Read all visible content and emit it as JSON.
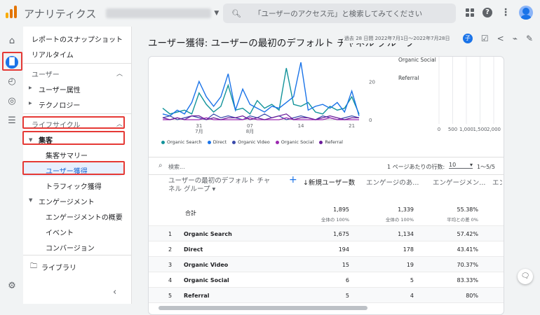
{
  "app": {
    "brand": "アナリティクス"
  },
  "search": {
    "placeholder": "「ユーザーのアクセス元」と検索してみてください"
  },
  "nav": {
    "snapshot": "レポートのスナップショット",
    "realtime": "リアルタイム",
    "user_section": "ユーザー",
    "user_attr": "ユーザー属性",
    "tech": "テクノロジー",
    "lifecycle": "ライフサイクル",
    "acquisition": "集客",
    "acq_overview": "集客サマリー",
    "user_acq": "ユーザー獲得",
    "traffic_acq": "トラフィック獲得",
    "engagement": "エンゲージメント",
    "eng_overview": "エンゲージメントの概要",
    "events": "イベント",
    "conversions": "コンバージョン",
    "library": "ライブラリ"
  },
  "page": {
    "title": "ユーザー獲得: ユーザーの最初のデフォルト チャネル グループ",
    "date": "過去 28 日間 2022年7月1日～2022年7月28日",
    "badge": "子"
  },
  "chart_data": {
    "type": "line",
    "x_tick_labels": [
      "31\n7月",
      "07\n8月",
      "14",
      "21"
    ],
    "y_ticks": [
      0,
      20
    ],
    "series": [
      {
        "name": "Organic Search",
        "color": "#12939a",
        "values": [
          6,
          3,
          4,
          5,
          3,
          14,
          8,
          4,
          7,
          18,
          5,
          6,
          3,
          10,
          6,
          8,
          5,
          27,
          8,
          7,
          9,
          4,
          3,
          7,
          5,
          6,
          12,
          3
        ]
      },
      {
        "name": "Direct",
        "color": "#1a73e8",
        "values": [
          3,
          2,
          5,
          3,
          9,
          20,
          12,
          7,
          12,
          24,
          5,
          16,
          8,
          6,
          4,
          7,
          6,
          9,
          12,
          30,
          5,
          7,
          8,
          6,
          9,
          4,
          15,
          2
        ]
      },
      {
        "name": "Organic Video",
        "color": "#3949ab",
        "values": [
          1,
          2,
          0,
          1,
          2,
          1,
          0,
          3,
          1,
          2,
          1,
          0,
          2,
          1,
          3,
          1,
          2,
          0,
          1,
          2,
          1,
          0,
          2,
          1,
          0,
          1,
          2,
          1
        ]
      },
      {
        "name": "Organic Social",
        "color": "#9c27b0",
        "values": [
          0,
          0,
          1,
          0,
          0,
          0,
          1,
          0,
          0,
          0,
          0,
          0,
          1,
          0,
          0,
          0,
          0,
          1,
          0,
          0,
          0,
          0,
          0,
          1,
          0,
          0,
          0,
          0
        ]
      },
      {
        "name": "Referral",
        "color": "#6a1b9a",
        "values": [
          1,
          0,
          1,
          0,
          2,
          2,
          0,
          1,
          0,
          1,
          1,
          2,
          0,
          1,
          0,
          1,
          2,
          3,
          0,
          1,
          1,
          0,
          1,
          2,
          1,
          0,
          1,
          1
        ]
      }
    ],
    "bar_chart": {
      "type": "bar",
      "categories": [
        "Organic Social",
        "Referral"
      ],
      "x_ticks": [
        0,
        500,
        1000,
        1500,
        2000
      ]
    }
  },
  "table": {
    "search_placeholder": "検索...",
    "rows_per_page_label": "1 ページあたりの行数:",
    "rows_per_page": "10",
    "pagination": "1〜5/5",
    "col_dim": "ユーザーの最初のデフォルト チャネル グループ",
    "col_new_users": "↓新規ユーザー数",
    "col_eng_sessions": "エンゲージのあ...",
    "col_eng_rate": "エンゲージメン...",
    "col_more": "エン ユー",
    "total_label": "合計",
    "totals": {
      "new_users": "1,895",
      "new_users_sub": "全体の 100%",
      "eng": "1,339",
      "eng_sub": "全体の 100%",
      "rate": "55.38%",
      "rate_sub": "平均との差 0%"
    },
    "rows": [
      {
        "idx": "1",
        "name": "Organic Search",
        "new_users": "1,675",
        "eng": "1,134",
        "rate": "57.42%"
      },
      {
        "idx": "2",
        "name": "Direct",
        "new_users": "194",
        "eng": "178",
        "rate": "43.41%"
      },
      {
        "idx": "3",
        "name": "Organic Video",
        "new_users": "15",
        "eng": "19",
        "rate": "70.37%"
      },
      {
        "idx": "4",
        "name": "Organic Social",
        "new_users": "6",
        "eng": "5",
        "rate": "83.33%"
      },
      {
        "idx": "5",
        "name": "Referral",
        "new_users": "5",
        "eng": "4",
        "rate": "80%"
      }
    ]
  }
}
